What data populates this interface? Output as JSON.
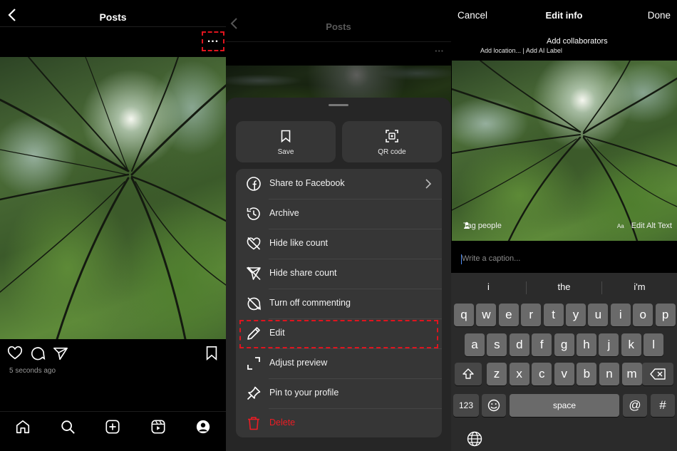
{
  "panel1": {
    "title": "Posts",
    "more_label": "...",
    "timestamp": "5 seconds ago",
    "tab_icons": [
      "home-icon",
      "search-icon",
      "create-icon",
      "reels-icon",
      "profile-icon"
    ]
  },
  "panel2": {
    "bg_title": "Posts",
    "tiles": [
      {
        "label": "Save",
        "icon": "bookmark-icon"
      },
      {
        "label": "QR code",
        "icon": "qr-code-icon"
      }
    ],
    "items": [
      {
        "label": "Share to Facebook",
        "icon": "facebook-icon",
        "chevron": true
      },
      {
        "label": "Archive",
        "icon": "archive-icon"
      },
      {
        "label": "Hide like count",
        "icon": "hide-like-icon"
      },
      {
        "label": "Hide share count",
        "icon": "hide-share-icon"
      },
      {
        "label": "Turn off commenting",
        "icon": "comment-off-icon"
      },
      {
        "label": "Edit",
        "icon": "pencil-icon"
      },
      {
        "label": "Adjust preview",
        "icon": "crop-icon"
      },
      {
        "label": "Pin to your profile",
        "icon": "pin-icon"
      },
      {
        "label": "Delete",
        "icon": "trash-icon",
        "danger": true
      }
    ],
    "danger_color": "#ed1c24"
  },
  "panel3": {
    "cancel": "Cancel",
    "title": "Edit info",
    "done": "Done",
    "add_collaborators": "Add collaborators",
    "location_line": "Add location... | Add AI Label",
    "tag_people": "Tag people",
    "alt_prefix": "Aa",
    "edit_alt": "Edit Alt Text",
    "caption_placeholder": "Write a caption...",
    "suggestions": [
      "i",
      "the",
      "i'm"
    ],
    "rows": [
      [
        "q",
        "w",
        "e",
        "r",
        "t",
        "y",
        "u",
        "i",
        "o",
        "p"
      ],
      [
        "a",
        "s",
        "d",
        "f",
        "g",
        "h",
        "j",
        "k",
        "l"
      ],
      [
        "z",
        "x",
        "c",
        "v",
        "b",
        "n",
        "m"
      ]
    ],
    "key_123": "123",
    "key_space": "space",
    "key_at": "@",
    "key_hash": "#"
  },
  "colors": {
    "highlight": "#e0141e",
    "caret": "#4f8df5"
  }
}
